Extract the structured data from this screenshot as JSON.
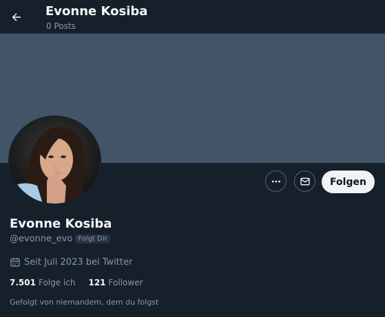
{
  "header": {
    "title": "Evonne Kosiba",
    "subtitle": "0 Posts",
    "back_icon": "arrow-left-icon"
  },
  "profile": {
    "name": "Evonne Kosiba",
    "handle": "@evonne_evo",
    "follows_you_badge": "Folgt Dir",
    "joined": "Seit Juli 2023 bei Twitter",
    "following_count": "7.501",
    "following_label": "Folge ich",
    "followers_count": "121",
    "followers_label": "Follower",
    "followed_by": "Gefolgt von niemandem, dem du folgst"
  },
  "actions": {
    "more_icon": "more-horizontal-icon",
    "message_icon": "envelope-icon",
    "follow_label": "Folgen"
  },
  "colors": {
    "background": "#15202b",
    "banner": "#425466",
    "text_primary": "#f7f9f9",
    "text_secondary": "#8b98a5",
    "follow_button_bg": "#eff3f4"
  }
}
